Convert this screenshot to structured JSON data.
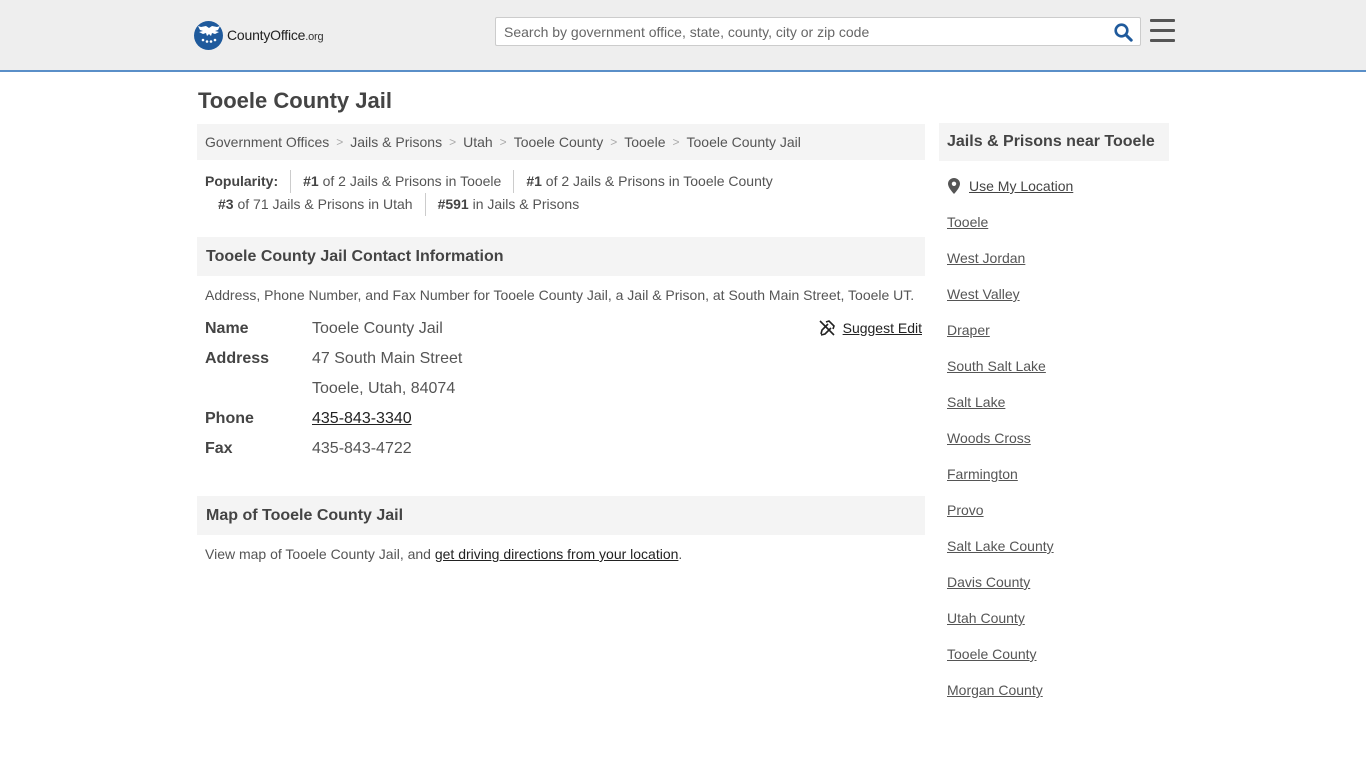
{
  "header": {
    "logo_text": "CountyOffice",
    "logo_suffix": ".org",
    "search_placeholder": "Search by government office, state, county, city or zip code"
  },
  "page": {
    "title": "Tooele County Jail"
  },
  "breadcrumb": [
    "Government Offices",
    "Jails & Prisons",
    "Utah",
    "Tooele County",
    "Tooele",
    "Tooele County Jail"
  ],
  "popularity": {
    "label": "Popularity:",
    "items": [
      {
        "rank": "#1",
        "text": "of 2 Jails & Prisons in Tooele"
      },
      {
        "rank": "#1",
        "text": "of 2 Jails & Prisons in Tooele County"
      },
      {
        "rank": "#3",
        "text": "of 71 Jails & Prisons in Utah"
      },
      {
        "rank": "#591",
        "text": "in Jails & Prisons"
      }
    ]
  },
  "contact": {
    "heading": "Tooele County Jail Contact Information",
    "description": "Address, Phone Number, and Fax Number for Tooele County Jail, a Jail & Prison, at South Main Street, Tooele UT.",
    "suggest_edit": "Suggest Edit",
    "name_label": "Name",
    "name_value": "Tooele County Jail",
    "address_label": "Address",
    "address_line1": "47 South Main Street",
    "address_line2": "Tooele, Utah, 84074",
    "phone_label": "Phone",
    "phone_value": "435-843-3340",
    "fax_label": "Fax",
    "fax_value": "435-843-4722"
  },
  "map": {
    "heading": "Map of Tooele County Jail",
    "desc_prefix": "View map of Tooele County Jail, and ",
    "desc_link": "get driving directions from your location",
    "desc_suffix": "."
  },
  "sidebar": {
    "heading": "Jails & Prisons near Tooele",
    "use_location": "Use My Location",
    "links": [
      "Tooele",
      "West Jordan",
      "West Valley",
      "Draper",
      "South Salt Lake",
      "Salt Lake",
      "Woods Cross",
      "Farmington",
      "Provo",
      "Salt Lake County",
      "Davis County",
      "Utah County",
      "Tooele County",
      "Morgan County"
    ]
  },
  "colors": {
    "accent": "#1f5a9c",
    "header_bg": "#eeeeee",
    "header_border": "#5a8fc8",
    "panel_bg": "#f4f4f4"
  }
}
